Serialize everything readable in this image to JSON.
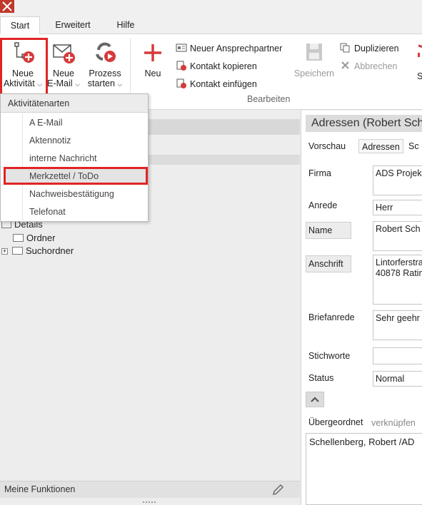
{
  "tabs": [
    {
      "label": "Start",
      "active": true
    },
    {
      "label": "Erweitert",
      "active": false
    },
    {
      "label": "Hilfe",
      "active": false
    }
  ],
  "ribbon": {
    "neue_aktivitaet": {
      "line1": "Neue",
      "line2": "Aktivität"
    },
    "neue_email": {
      "line1": "Neue",
      "line2": "E-Mail"
    },
    "prozess": {
      "line1": "Prozess",
      "line2": "starten"
    },
    "neu": "Neu",
    "neuer_ansprechpartner": "Neuer Ansprechpartner",
    "kontakt_kopieren": "Kontakt kopieren",
    "kontakt_einfuegen": "Kontakt einfügen",
    "speichern": "Speichern",
    "duplizieren": "Duplizieren",
    "abbrechen": "Abbrechen",
    "group_bearbeiten": "Bearbeiten",
    "accent_color": "#d63a3a"
  },
  "dropdown": {
    "header": "Aktivitätenarten",
    "items": [
      "A E-Mail",
      "Aktennotiz",
      "interne Nachricht",
      "Merkzettel / ToDo",
      "Nachweisbestätigung",
      "Telefonat"
    ],
    "selected_index": 3
  },
  "tree": {
    "details": "Details",
    "ordner": "Ordner",
    "suchordner": "Suchordner"
  },
  "footer": {
    "meine_funktionen": "Meine Funktionen"
  },
  "detail": {
    "title": "Adressen (Robert Sch",
    "tabs": [
      "Vorschau",
      "Adressen",
      "Sc"
    ],
    "fields": {
      "firma_label": "Firma",
      "firma_value": "ADS Projek",
      "anrede_label": "Anrede",
      "anrede_value": "Herr",
      "name_label": "Name",
      "name_value": "Robert Sch",
      "anschrift_label": "Anschrift",
      "anschrift_value": "Lintorferstra\n40878 Ratin",
      "briefanrede_label": "Briefanrede",
      "briefanrede_value": "Sehr geehr",
      "stichworte_label": "Stichworte",
      "stichworte_value": "",
      "status_label": "Status",
      "status_value": "Normal"
    },
    "uebergeordnet_label": "Übergeordnet",
    "verknuepfen_label": "verknüpfen",
    "uebergeordnet_value": "Schellenberg, Robert /AD"
  }
}
